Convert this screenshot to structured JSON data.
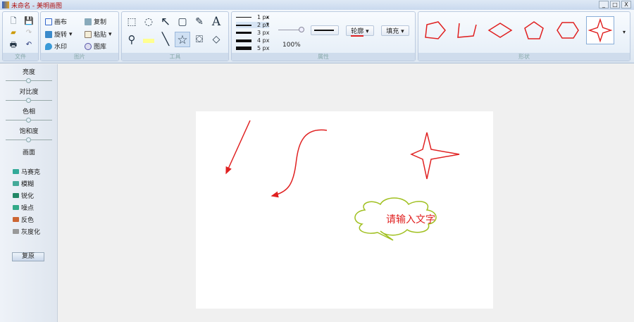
{
  "window": {
    "title": "未命名 - 美明画图",
    "buttons": [
      "_",
      "□",
      "X"
    ]
  },
  "ribbon": {
    "file": {
      "label": "文件"
    },
    "image": {
      "label": "图片",
      "canvas": "画布",
      "rotate": "旋转",
      "watermark": "水印",
      "copy": "复制",
      "paste": "粘贴",
      "gallery": "图库"
    },
    "tools": {
      "label": "工具"
    },
    "properties": {
      "label": "属性",
      "line_widths": [
        "1 px",
        "2 px",
        "3 px",
        "4 px",
        "5 px"
      ],
      "selected_width": "2 px",
      "zoom": "100%",
      "outline": "轮廓",
      "fill": "填充"
    },
    "shapes": {
      "label": "形状",
      "accent": "#e02020"
    }
  },
  "sidebar": {
    "sliders": [
      {
        "label": "亮度",
        "value": 0.5
      },
      {
        "label": "对比度",
        "value": 0.5
      },
      {
        "label": "色相",
        "value": 0.5
      },
      {
        "label": "饱和度",
        "value": 0.5
      }
    ],
    "section": "画面",
    "effects": [
      "马赛克",
      "模糊",
      "锐化",
      "噪点",
      "反色",
      "灰度化"
    ],
    "reset": "复原"
  },
  "canvas": {
    "callout_text": "请输入文字",
    "stroke": "#e02020",
    "callout_color": "#a0c020"
  }
}
